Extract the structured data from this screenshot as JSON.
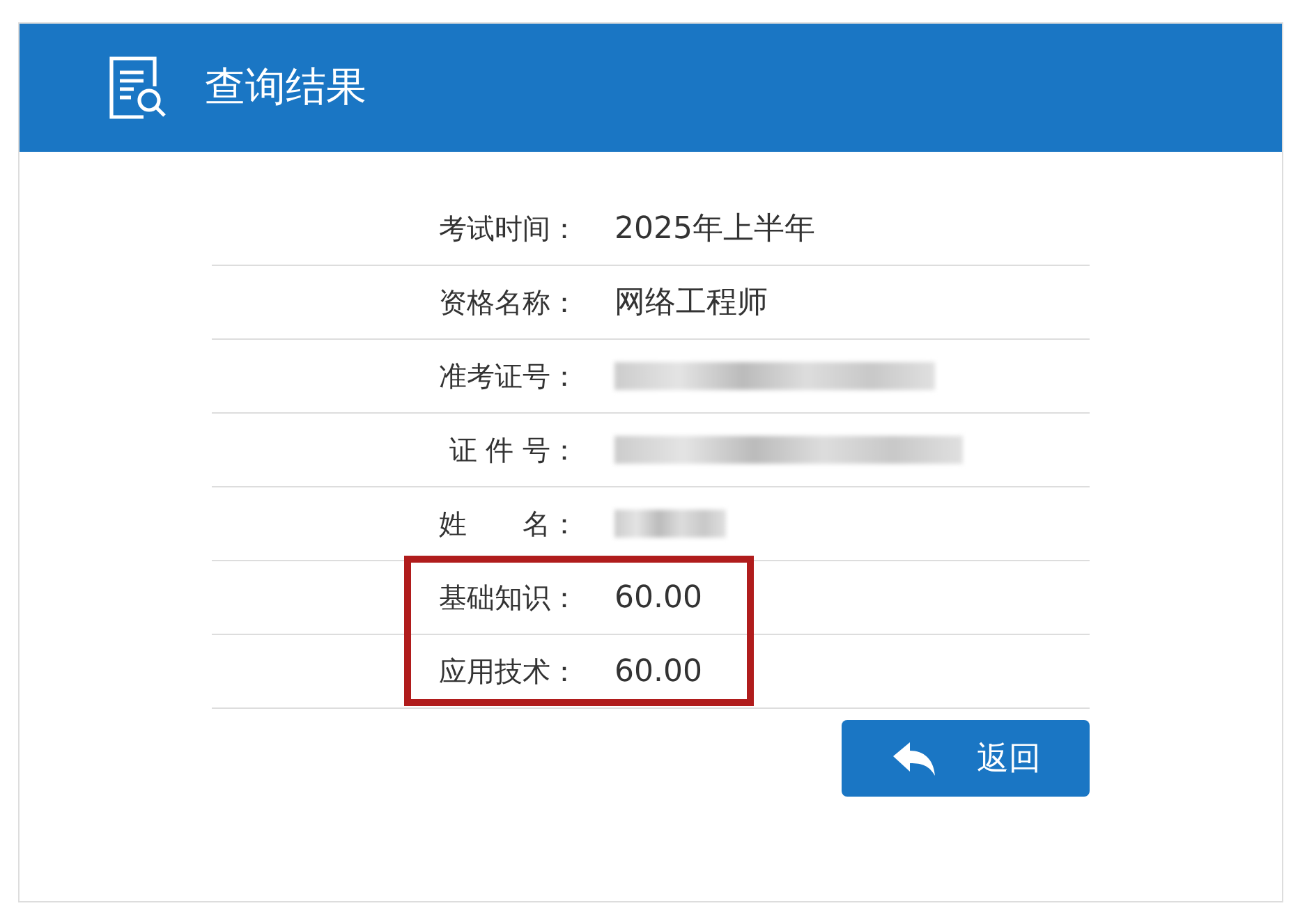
{
  "header": {
    "title": "查询结果"
  },
  "rows": [
    {
      "label": "考试时间：",
      "kind": "text",
      "value": "2025年上半年",
      "highlighted": false
    },
    {
      "label": "资格名称：",
      "kind": "text",
      "value": "网络工程师",
      "highlighted": false
    },
    {
      "label": "准考证号：",
      "kind": "redacted",
      "highlighted": false
    },
    {
      "label": "证 件 号：",
      "kind": "redacted",
      "highlighted": false
    },
    {
      "label": "姓　　名：",
      "kind": "redacted",
      "highlighted": false
    },
    {
      "label": "基础知识：",
      "kind": "text",
      "value": "60.00",
      "highlighted": true
    },
    {
      "label": "应用技术：",
      "kind": "text",
      "value": "60.00",
      "highlighted": true
    }
  ],
  "back_button": {
    "label": "返回"
  }
}
